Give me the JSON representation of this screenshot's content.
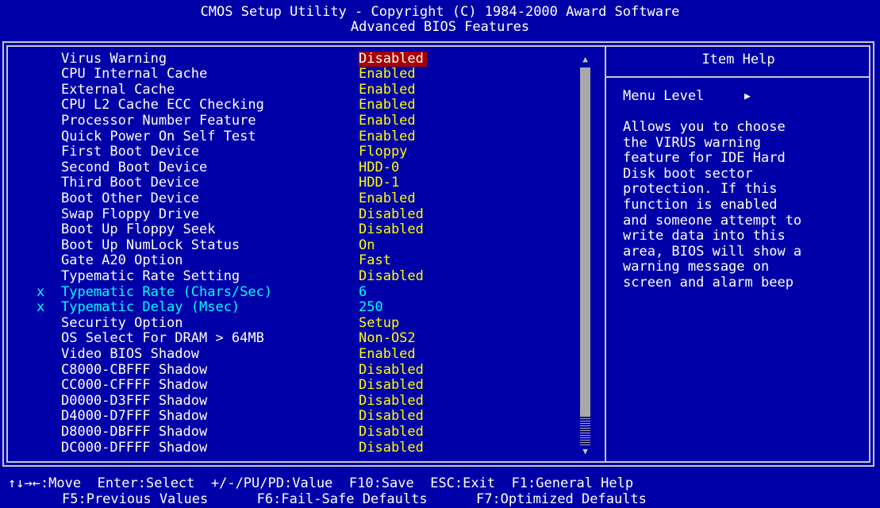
{
  "header": {
    "line1": "CMOS Setup Utility - Copyright (C) 1984-2000 Award Software",
    "line2": "Advanced BIOS Features"
  },
  "settings": [
    {
      "label": "Virus Warning",
      "value": "Disabled",
      "selected": true,
      "greyed": false,
      "mark": ""
    },
    {
      "label": "CPU Internal Cache",
      "value": "Enabled",
      "greyed": false,
      "mark": ""
    },
    {
      "label": "External Cache",
      "value": "Enabled",
      "greyed": false,
      "mark": ""
    },
    {
      "label": "CPU L2 Cache ECC Checking",
      "value": "Enabled",
      "greyed": false,
      "mark": ""
    },
    {
      "label": "Processor Number Feature",
      "value": "Enabled",
      "greyed": false,
      "mark": ""
    },
    {
      "label": "Quick Power On Self Test",
      "value": "Enabled",
      "greyed": false,
      "mark": ""
    },
    {
      "label": "First Boot Device",
      "value": "Floppy",
      "greyed": false,
      "mark": ""
    },
    {
      "label": "Second Boot Device",
      "value": "HDD-0",
      "greyed": false,
      "mark": ""
    },
    {
      "label": "Third Boot Device",
      "value": "HDD-1",
      "greyed": false,
      "mark": ""
    },
    {
      "label": "Boot Other Device",
      "value": "Enabled",
      "greyed": false,
      "mark": ""
    },
    {
      "label": "Swap Floppy Drive",
      "value": "Disabled",
      "greyed": false,
      "mark": ""
    },
    {
      "label": "Boot Up Floppy Seek",
      "value": "Disabled",
      "greyed": false,
      "mark": ""
    },
    {
      "label": "Boot Up NumLock Status",
      "value": "On",
      "greyed": false,
      "mark": ""
    },
    {
      "label": "Gate A20 Option",
      "value": "Fast",
      "greyed": false,
      "mark": ""
    },
    {
      "label": "Typematic Rate Setting",
      "value": "Disabled",
      "greyed": false,
      "mark": ""
    },
    {
      "label": "Typematic Rate (Chars/Sec)",
      "value": "6",
      "greyed": true,
      "mark": "x"
    },
    {
      "label": "Typematic Delay (Msec)",
      "value": "250",
      "greyed": true,
      "mark": "x"
    },
    {
      "label": "Security Option",
      "value": "Setup",
      "greyed": false,
      "mark": ""
    },
    {
      "label": "OS Select For DRAM > 64MB",
      "value": "Non-OS2",
      "greyed": false,
      "mark": ""
    },
    {
      "label": "Video BIOS Shadow",
      "value": "Enabled",
      "greyed": false,
      "mark": ""
    },
    {
      "label": "C8000-CBFFF Shadow",
      "value": "Disabled",
      "greyed": false,
      "mark": ""
    },
    {
      "label": "CC000-CFFFF Shadow",
      "value": "Disabled",
      "greyed": false,
      "mark": ""
    },
    {
      "label": "D0000-D3FFF Shadow",
      "value": "Disabled",
      "greyed": false,
      "mark": ""
    },
    {
      "label": "D4000-D7FFF Shadow",
      "value": "Disabled",
      "greyed": false,
      "mark": ""
    },
    {
      "label": "D8000-DBFFF Shadow",
      "value": "Disabled",
      "greyed": false,
      "mark": ""
    },
    {
      "label": "DC000-DFFFF Shadow",
      "value": "Disabled",
      "greyed": false,
      "mark": ""
    }
  ],
  "scrollbar": {
    "up_icon": "triangle-up",
    "down_icon": "triangle-down"
  },
  "help": {
    "title": "Item Help",
    "menu_level": "Menu Level",
    "menu_level_icon": "triangle-right",
    "lines": [
      "Allows you to choose",
      "the VIRUS warning",
      "feature for IDE Hard",
      "Disk boot sector",
      "protection. If this",
      "function is enabled",
      "and someone attempt to",
      "write data into this",
      "area, BIOS will show a",
      "warning message on",
      "screen and alarm beep"
    ]
  },
  "footer": {
    "line1": "↑↓→←:Move  Enter:Select  +/-/PU/PD:Value  F10:Save  ESC:Exit  F1:General Help",
    "line2": "F5:Previous Values      F6:Fail-Safe Defaults      F7:Optimized Defaults"
  },
  "colors": {
    "background": "#0000a8",
    "text": "#ffffff",
    "value": "#ffff00",
    "greyed": "#00ffff",
    "selected_bg": "#a80000",
    "frame": "#c8c8c8"
  }
}
